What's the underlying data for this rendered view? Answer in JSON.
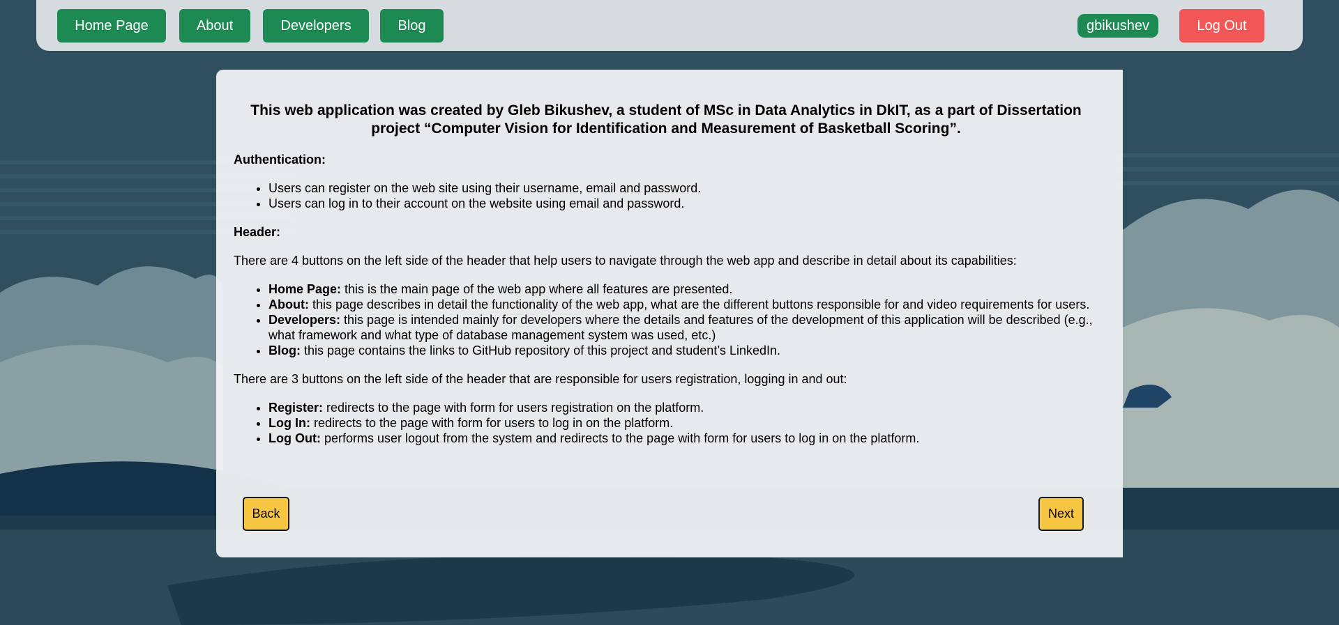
{
  "nav": {
    "home_label": "Home Page",
    "about_label": "About",
    "developers_label": "Developers",
    "blog_label": "Blog"
  },
  "user": {
    "username": "gbikushev",
    "logout_label": "Log Out"
  },
  "page": {
    "title": "This web application was created by Gleb Bikushev, a student of MSc in Data Analytics in DkIT, as a part of Dissertation project “Computer Vision for Identification and Measurement of Basketball Scoring”.",
    "auth_heading": "Authentication:",
    "auth_items": [
      "Users can register on the web site using their username, email and password.",
      "Users can log in to their account on the website using email and password."
    ],
    "header_heading": "Header:",
    "header_intro": "There are 4 buttons on the left side of the header that help users to navigate through the web app and describe in detail about its capabilities:",
    "nav_items": [
      {
        "term": "Home Page:",
        "desc": " this is the main page of the web app where all features are presented."
      },
      {
        "term": "About:",
        "desc": " this page describes in detail the functionality of the web app, what are the different buttons responsible for and video requirements for users."
      },
      {
        "term": "Developers:",
        "desc": " this page is intended mainly for developers where the details and features of the development of this application will be described (e.g., what framework and what type of database management system was used, etc.)"
      },
      {
        "term": "Blog:",
        "desc": " this page contains the links to GitHub repository of this project and student’s LinkedIn."
      }
    ],
    "account_intro": "There are 3 buttons on the left side of the header that are responsible for users registration, logging in and out:",
    "account_items": [
      {
        "term": "Register:",
        "desc": " redirects to the page with form for users registration on the platform."
      },
      {
        "term": "Log In:",
        "desc": " redirects to the page with form for users to log in on the platform."
      },
      {
        "term": "Log Out:",
        "desc": " performs user logout from the system and redirects to the page with form for users to log in on the platform."
      }
    ],
    "back_label": "Back",
    "next_label": "Next"
  },
  "colors": {
    "nav_button": "#1d8a54",
    "logout_button": "#f25757",
    "pager_button": "#f7c744",
    "header_bg": "#d6dbe0"
  },
  "icons": {
    "scroll_up": "scroll-up-arrow-icon",
    "scroll_down": "scroll-down-arrow-icon"
  }
}
